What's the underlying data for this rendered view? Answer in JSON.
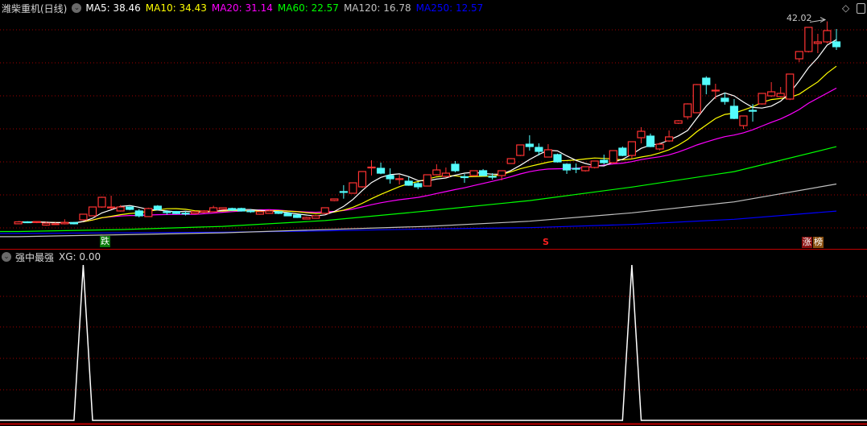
{
  "header": {
    "title": "潍柴重机(日线)",
    "ma": [
      {
        "label": "MA5: 38.46",
        "color": "#ffffff"
      },
      {
        "label": "MA10: 34.43",
        "color": "#ffff00"
      },
      {
        "label": "MA20: 31.14",
        "color": "#ff00ff"
      },
      {
        "label": "MA60: 22.57",
        "color": "#00ff00"
      },
      {
        "label": "MA120: 16.78",
        "color": "#c0c0c0"
      },
      {
        "label": "MA250: 12.57",
        "color": "#0000ff"
      }
    ]
  },
  "indicator": {
    "title": "强中最强",
    "value_label": "XG: 0.00"
  },
  "markers": {
    "fall": "跌",
    "signal": "S",
    "rise_1": "涨",
    "rise_2": "榜",
    "high_label": "42.02"
  },
  "colors": {
    "up": "#ff3232",
    "down": "#54fcfc",
    "grid": "#a00000",
    "separator": "#c00000"
  },
  "chart_data": {
    "type": "candlestick",
    "title": "潍柴重机(日线)",
    "candles": [
      [
        10.6,
        10.95,
        10.55,
        10.9
      ],
      [
        10.9,
        11.0,
        10.7,
        10.8
      ],
      [
        10.8,
        11.0,
        10.7,
        10.95
      ],
      [
        10.4,
        10.9,
        10.3,
        10.7
      ],
      [
        10.6,
        10.8,
        10.4,
        10.6
      ],
      [
        10.6,
        11.3,
        10.5,
        10.8
      ],
      [
        10.8,
        10.9,
        10.5,
        10.6
      ],
      [
        11.21,
        11.4,
        11.1,
        12.09
      ],
      [
        11.84,
        13.21,
        11.8,
        13.21
      ],
      [
        13.21,
        14.8,
        13.1,
        14.71
      ],
      [
        13.2,
        14.96,
        12.84,
        13.2
      ],
      [
        12.59,
        13.5,
        12.5,
        13.21
      ],
      [
        13.21,
        13.3,
        12.7,
        12.84
      ],
      [
        12.59,
        12.9,
        11.6,
        11.84
      ],
      [
        11.72,
        13.1,
        11.7,
        12.97
      ],
      [
        13.34,
        13.5,
        12.7,
        12.84
      ],
      [
        12.47,
        12.7,
        12.0,
        12.45
      ],
      [
        12.5,
        12.6,
        12.1,
        12.2
      ],
      [
        12.25,
        12.6,
        11.9,
        12.2
      ],
      [
        12.2,
        12.5,
        12.1,
        12.47
      ],
      [
        12.4,
        12.7,
        12.3,
        12.6
      ],
      [
        12.47,
        13.4,
        12.4,
        13.09
      ],
      [
        12.84,
        13.1,
        12.8,
        13.09
      ],
      [
        12.97,
        13.1,
        12.6,
        12.72
      ],
      [
        12.97,
        13.1,
        12.5,
        12.59
      ],
      [
        12.6,
        12.9,
        12.3,
        12.55
      ],
      [
        12.09,
        12.6,
        12.0,
        12.47
      ],
      [
        12.22,
        12.8,
        12.2,
        12.59
      ],
      [
        12.47,
        12.6,
        12.1,
        12.22
      ],
      [
        12.22,
        12.3,
        11.8,
        11.84
      ],
      [
        11.97,
        12.0,
        11.5,
        11.59
      ],
      [
        11.34,
        11.7,
        11.3,
        11.59
      ],
      [
        11.46,
        12.0,
        11.4,
        11.84
      ],
      [
        12.22,
        13.1,
        12.1,
        13.09
      ],
      [
        14.21,
        14.5,
        14.1,
        14.46
      ],
      [
        15.6,
        16.6,
        14.5,
        15.5
      ],
      [
        15.34,
        17.0,
        15.3,
        16.96
      ],
      [
        16.34,
        18.71,
        16.2,
        18.71
      ],
      [
        19.3,
        20.46,
        18.1,
        19.4
      ],
      [
        19.21,
        20.1,
        18.3,
        18.46
      ],
      [
        18.09,
        19.21,
        16.84,
        17.59
      ],
      [
        17.5,
        18.2,
        16.7,
        17.6
      ],
      [
        17.21,
        17.9,
        16.5,
        16.59
      ],
      [
        16.84,
        17.1,
        15.96,
        16.34
      ],
      [
        16.46,
        18.21,
        16.4,
        18.21
      ],
      [
        18.21,
        19.84,
        18.1,
        18.96
      ],
      [
        17.96,
        19.34,
        17.8,
        18.46
      ],
      [
        19.84,
        20.34,
        18.6,
        18.84
      ],
      [
        17.9,
        18.34,
        16.96,
        17.84
      ],
      [
        18.09,
        18.9,
        17.96,
        18.84
      ],
      [
        18.84,
        19.1,
        18.0,
        18.09
      ],
      [
        17.96,
        18.46,
        17.46,
        17.9
      ],
      [
        18.09,
        18.9,
        17.34,
        18.84
      ],
      [
        19.96,
        20.8,
        19.9,
        20.71
      ],
      [
        21.21,
        22.84,
        21.1,
        22.84
      ],
      [
        22.96,
        24.34,
        21.96,
        22.59
      ],
      [
        22.46,
        23.09,
        21.21,
        21.84
      ],
      [
        20.96,
        22.96,
        20.9,
        22.09
      ],
      [
        21.34,
        21.5,
        20.1,
        20.21
      ],
      [
        19.84,
        20.0,
        18.34,
        18.96
      ],
      [
        19.2,
        19.96,
        18.46,
        19.1
      ],
      [
        18.84,
        19.5,
        18.7,
        19.46
      ],
      [
        19.34,
        20.4,
        19.2,
        20.34
      ],
      [
        20.46,
        21.34,
        19.8,
        20.09
      ],
      [
        20.09,
        21.96,
        19.9,
        21.96
      ],
      [
        22.34,
        22.6,
        21.1,
        21.21
      ],
      [
        21.21,
        23.34,
        20.7,
        23.34
      ],
      [
        23.96,
        25.59,
        23.09,
        24.96
      ],
      [
        24.21,
        24.6,
        22.5,
        22.59
      ],
      [
        22.21,
        23.2,
        22.0,
        22.96
      ],
      [
        23.46,
        25.09,
        23.3,
        24.09
      ],
      [
        26.21,
        26.7,
        26.1,
        26.59
      ],
      [
        27.21,
        29.3,
        26.8,
        29.21
      ],
      [
        27.84,
        32.3,
        27.8,
        32.21
      ],
      [
        33.21,
        33.5,
        30.7,
        32.21
      ],
      [
        31.3,
        32.34,
        29.96,
        31.34
      ],
      [
        30.09,
        30.96,
        29.09,
        29.59
      ],
      [
        28.84,
        29.96,
        26.84,
        26.96
      ],
      [
        25.84,
        27.4,
        25.34,
        27.34
      ],
      [
        28.2,
        29.2,
        26.46,
        28.1
      ],
      [
        29.21,
        30.8,
        29.1,
        30.84
      ],
      [
        30.46,
        32.59,
        30.3,
        31.09
      ],
      [
        30.34,
        31.84,
        30.2,
        30.84
      ],
      [
        29.96,
        33.84,
        29.8,
        33.84
      ],
      [
        36.21,
        37.34,
        35.7,
        37.34
      ],
      [
        37.34,
        41.09,
        37.2,
        41.09
      ],
      [
        38.6,
        40.09,
        37.09,
        38.84
      ],
      [
        38.84,
        42.02,
        38.6,
        40.59
      ],
      [
        38.84,
        40.84,
        37.59,
        38.09
      ]
    ],
    "long_ma_sample_every": 11,
    "ma60": [
      9.4,
      9.7,
      10.2,
      11.1,
      12.6,
      14.2,
      16.3,
      18.7,
      22.57
    ],
    "ma120": [
      8.6,
      8.9,
      9.2,
      9.7,
      10.2,
      11.0,
      12.3,
      14.0,
      16.78
    ],
    "ma250": [
      9.1,
      9.2,
      9.3,
      9.5,
      9.8,
      10.0,
      10.5,
      11.3,
      12.57
    ],
    "short_ma_periods": [
      5,
      10,
      20
    ],
    "ylim": [
      8,
      44
    ],
    "high_marker": 42.02,
    "fall_marker_bar": 10,
    "signal_marker_bar": 58,
    "rise_marker_bar": 86,
    "xg": {
      "spike_bars": [
        7,
        66
      ],
      "range": [
        0,
        1
      ]
    }
  }
}
